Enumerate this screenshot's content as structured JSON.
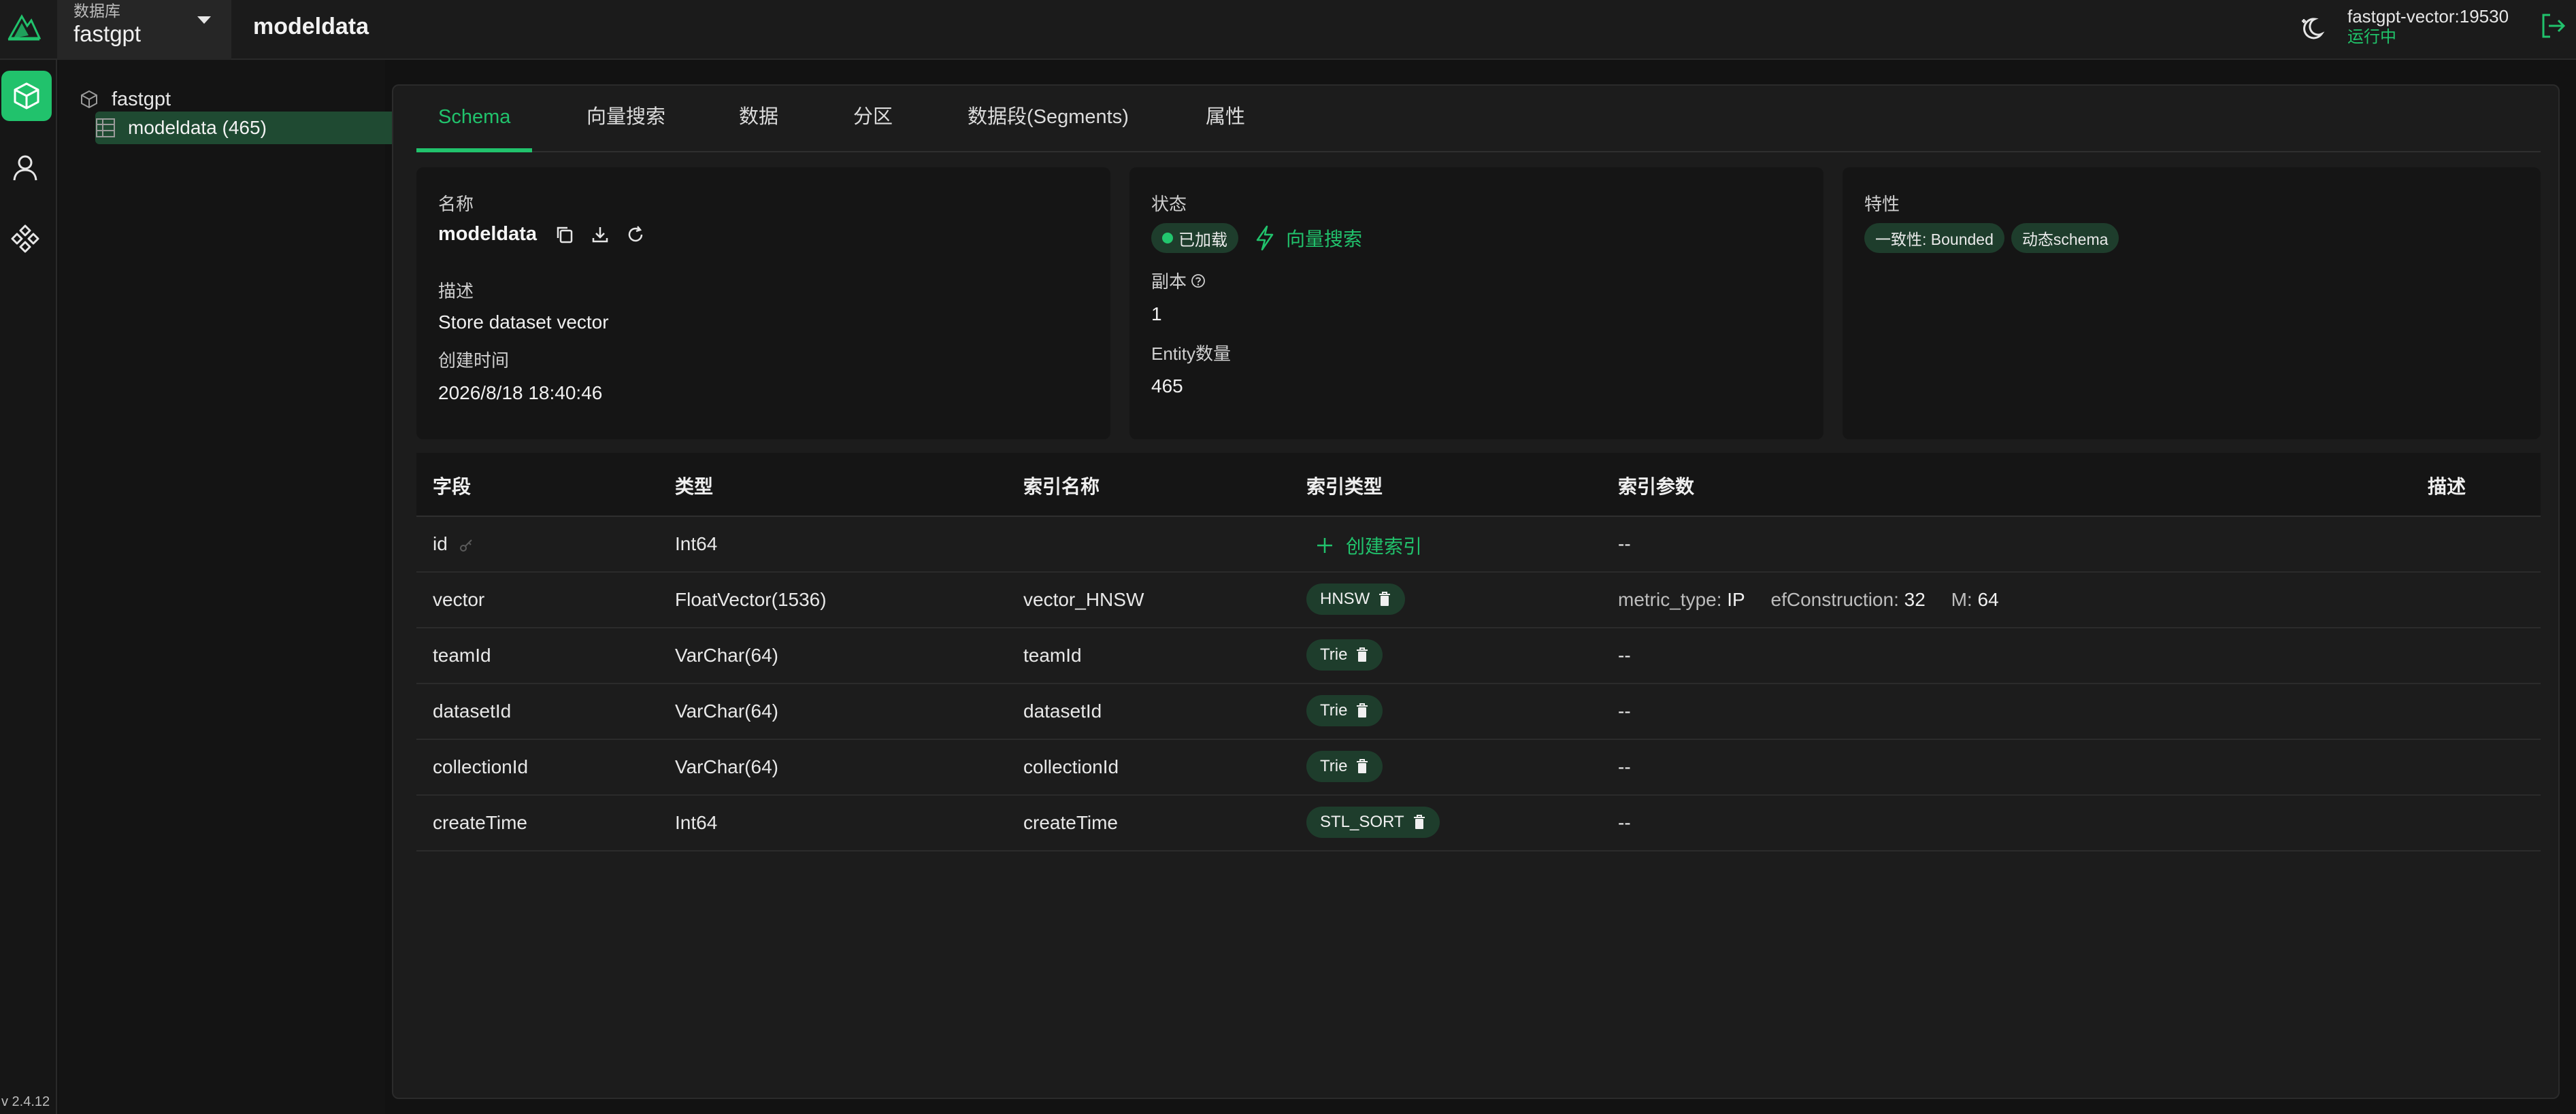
{
  "header": {
    "db_caption": "数据库",
    "db_value": "fastgpt",
    "page_title": "modeldata",
    "connection_address": "fastgpt-vector:19530",
    "connection_state": "运行中"
  },
  "rail": {
    "version": "v 2.4.12"
  },
  "tree": {
    "database": "fastgpt",
    "collection": "modeldata (465)"
  },
  "tabs": [
    {
      "label": "Schema"
    },
    {
      "label": "向量搜索"
    },
    {
      "label": "数据"
    },
    {
      "label": "分区"
    },
    {
      "label": "数据段(Segments)"
    },
    {
      "label": "属性"
    }
  ],
  "info_card": {
    "name_key": "名称",
    "name_value": "modeldata",
    "desc_key": "描述",
    "desc_value": "Store dataset vector",
    "created_key": "创建时间",
    "created_value": "2026/8/18 18:40:46"
  },
  "status_card": {
    "status_key": "状态",
    "loaded_label": "已加载",
    "vector_search_label": "向量搜索",
    "replica_key": "副本",
    "replica_value": "1",
    "entity_key": "Entity数量",
    "entity_value": "465"
  },
  "feature_card": {
    "key": "特性",
    "tags": [
      "一致性: Bounded",
      "动态schema"
    ]
  },
  "table": {
    "headers": {
      "field": "字段",
      "type": "类型",
      "index_name": "索引名称",
      "index_type": "索引类型",
      "index_params": "索引参数",
      "description": "描述"
    },
    "create_index_label": "创建索引",
    "rows": [
      {
        "field": "id",
        "type": "Int64",
        "index_name": "",
        "index_type": "",
        "params": "--"
      },
      {
        "field": "vector",
        "type": "FloatVector(1536)",
        "index_name": "vector_HNSW",
        "index_type": "HNSW",
        "params": [
          {
            "k": "metric_type: ",
            "v": "IP"
          },
          {
            "k": "efConstruction: ",
            "v": "32"
          },
          {
            "k": "M: ",
            "v": "64"
          }
        ]
      },
      {
        "field": "teamId",
        "type": "VarChar(64)",
        "index_name": "teamId",
        "index_type": "Trie",
        "params": "--"
      },
      {
        "field": "datasetId",
        "type": "VarChar(64)",
        "index_name": "datasetId",
        "index_type": "Trie",
        "params": "--"
      },
      {
        "field": "collectionId",
        "type": "VarChar(64)",
        "index_name": "collectionId",
        "index_type": "Trie",
        "params": "--"
      },
      {
        "field": "createTime",
        "type": "Int64",
        "index_name": "createTime",
        "index_type": "STL_SORT",
        "params": "--"
      }
    ]
  },
  "colors": {
    "accent": "#21c26c",
    "pill_bg": "#1e3d2c",
    "selected_bg": "#1f4a32"
  }
}
